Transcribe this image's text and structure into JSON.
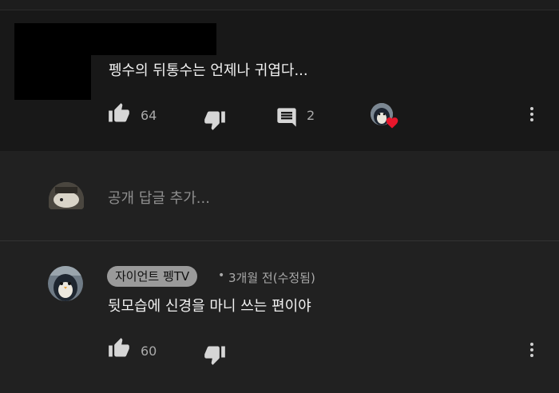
{
  "colors": {
    "background": "#212121",
    "highlighted_comment_bg": "#181818",
    "heart": "#e8162b"
  },
  "highlighted_comment": {
    "text": "펭수의 뒤통수는 언제나 귀엽다...",
    "like_count": "64",
    "reply_count": "2",
    "icons": [
      "thumb-up-icon",
      "thumb-down-icon",
      "comment-icon",
      "creator-heart-icon",
      "more-vert-icon"
    ]
  },
  "reply_input": {
    "placeholder": "공개 답글 추가..."
  },
  "reply": {
    "author": "자이언트 펭TV",
    "separator": "•",
    "meta": "3개월 전(수정됨)",
    "text": "뒷모습에 신경을 마니 쓰는 편이야",
    "like_count": "60",
    "icons": [
      "thumb-up-icon",
      "thumb-down-icon",
      "more-vert-icon"
    ]
  }
}
